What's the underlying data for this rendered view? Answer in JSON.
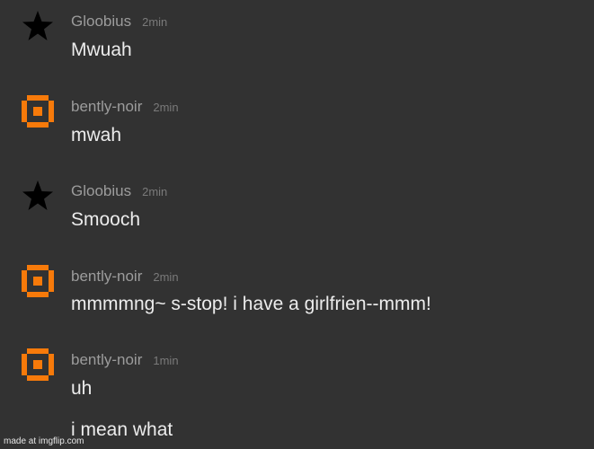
{
  "colors": {
    "background": "#323232",
    "username": "#9c9c9c",
    "timestamp": "#7a7a7a",
    "message_text": "#ececec",
    "orange_avatar": "#f77a0a"
  },
  "messages": [
    {
      "username": "Gloobius",
      "time": "2min",
      "avatar_icon": "star-icon",
      "lines": [
        "Mwuah"
      ]
    },
    {
      "username": "bently-noir",
      "time": "2min",
      "avatar_icon": "orange-pixel-avatar-icon",
      "lines": [
        "mwah"
      ]
    },
    {
      "username": "Gloobius",
      "time": "2min",
      "avatar_icon": "star-icon",
      "lines": [
        "Smooch"
      ]
    },
    {
      "username": "bently-noir",
      "time": "2min",
      "avatar_icon": "orange-pixel-avatar-icon",
      "lines": [
        "mmmmng~ s-stop! i have a girlfrien--mmm!"
      ]
    },
    {
      "username": "bently-noir",
      "time": "1min",
      "avatar_icon": "orange-pixel-avatar-icon",
      "lines": [
        "uh",
        "i mean what"
      ]
    }
  ],
  "watermark": "made at imgflip.com"
}
